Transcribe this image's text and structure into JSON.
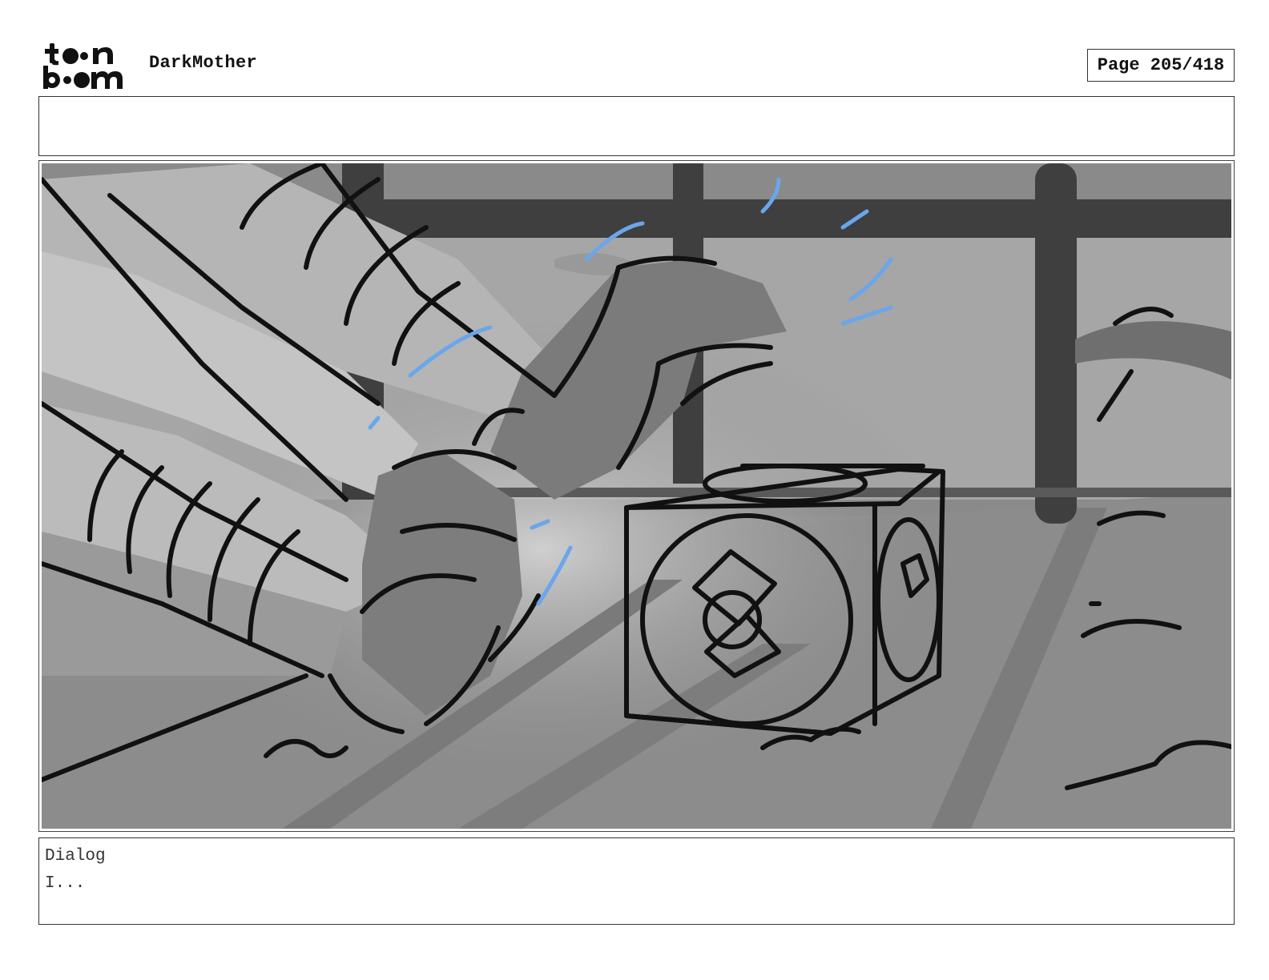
{
  "header": {
    "logo_line1": "toon",
    "logo_line2": "boom",
    "project_title": "DarkMother",
    "page_label": "Page 205/418"
  },
  "notes": {
    "text": ""
  },
  "panel": {
    "accent_color": "#6aa6ea"
  },
  "dialog": {
    "label": "Dialog",
    "text": "I..."
  }
}
